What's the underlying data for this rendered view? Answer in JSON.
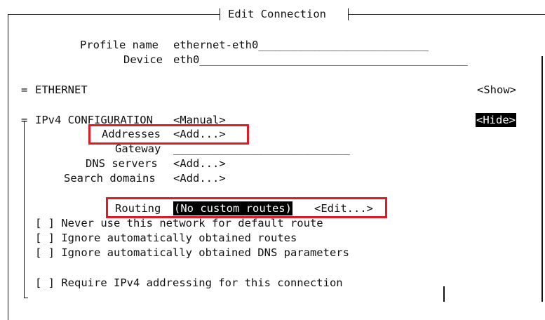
{
  "window": {
    "title": "Edit Connection"
  },
  "profile": {
    "profile_name_label": "Profile name",
    "profile_name_value": "ethernet-eth0",
    "profile_name_fill": "__________________________",
    "device_label": "Device",
    "device_value": "eth0",
    "device_fill": "_________________________________________"
  },
  "ethernet": {
    "marker": "=",
    "label": "ETHERNET",
    "toggle": "<Show>"
  },
  "ipv4": {
    "marker": "=",
    "label": "IPv4 CONFIGURATION",
    "method": "<Manual>",
    "toggle": "<Hide>",
    "addresses_label": "Addresses",
    "addresses_button": "<Add...>",
    "gateway_label": "Gateway",
    "gateway_fill": "___________________________",
    "dns_label": "DNS servers",
    "dns_button": "<Add...>",
    "search_label": "Search domains",
    "search_button": "<Add...>",
    "routing_label": "Routing",
    "routing_value": "(No custom routes)",
    "routing_button": "<Edit...>",
    "checkboxes": [
      {
        "box": "[ ]",
        "label": "Never use this network for default route"
      },
      {
        "box": "[ ]",
        "label": "Ignore automatically obtained routes"
      },
      {
        "box": "[ ]",
        "label": "Ignore automatically obtained DNS parameters"
      },
      {
        "box": "[ ]",
        "label": "Require IPv4 addressing for this connection"
      }
    ]
  },
  "colors": {
    "highlight": "#e01b24",
    "selected_bg": "#000000",
    "text": "#111111"
  }
}
